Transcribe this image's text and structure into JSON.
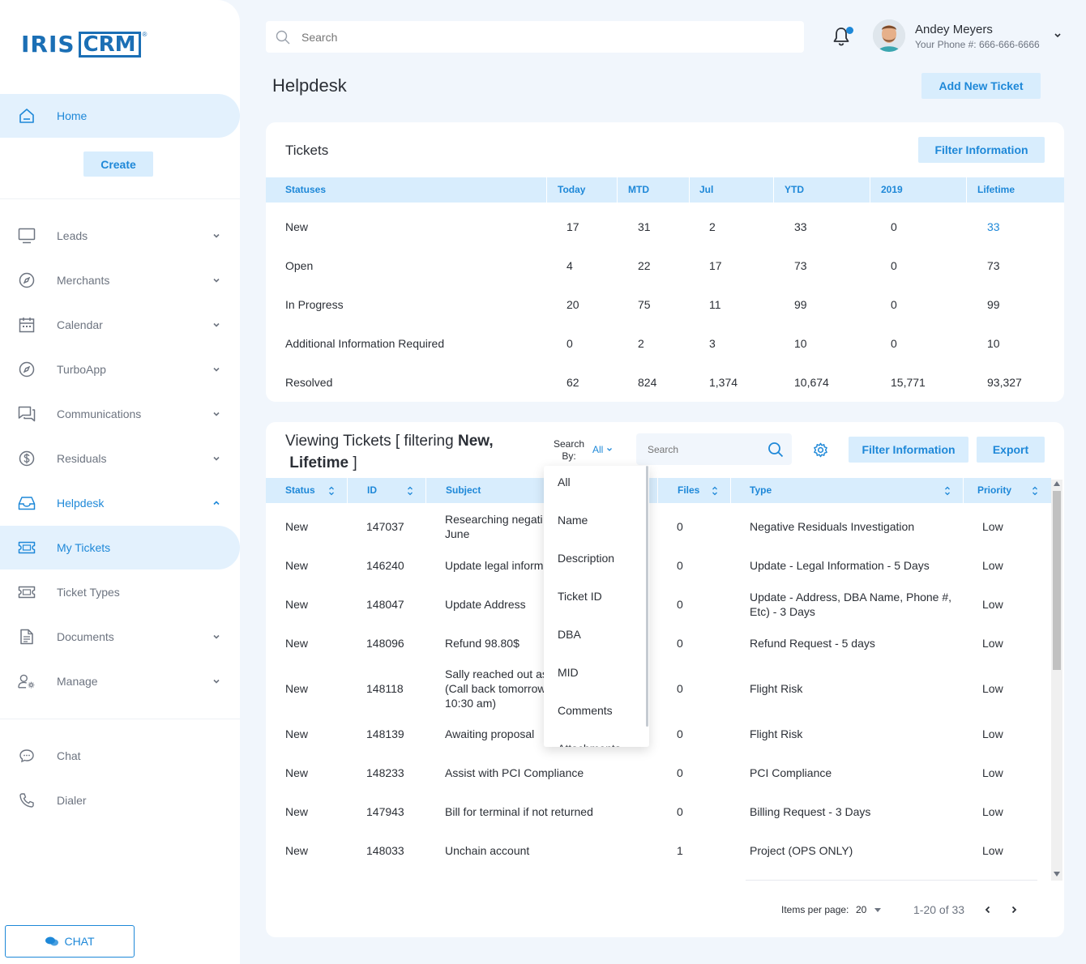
{
  "logo": {
    "part1": "IRIS",
    "part2": "CRM",
    "mark": "®"
  },
  "sidebar": {
    "home": "Home",
    "create": "Create",
    "items": [
      {
        "label": "Leads",
        "icon": "monitor-icon",
        "has_chevron": true
      },
      {
        "label": "Merchants",
        "icon": "compass-icon",
        "has_chevron": true
      },
      {
        "label": "Calendar",
        "icon": "calendar-icon",
        "has_chevron": true
      },
      {
        "label": "TurboApp",
        "icon": "compass-icon",
        "has_chevron": true
      },
      {
        "label": "Communications",
        "icon": "chat-bubbles-icon",
        "has_chevron": true
      },
      {
        "label": "Residuals",
        "icon": "dollar-icon",
        "has_chevron": true
      },
      {
        "label": "Helpdesk",
        "icon": "inbox-icon",
        "has_chevron": true,
        "expanded": true
      },
      {
        "label": "My Tickets",
        "icon": "ticket-icon",
        "has_chevron": false,
        "selected": true
      },
      {
        "label": "Ticket Types",
        "icon": "ticket-icon",
        "has_chevron": false
      },
      {
        "label": "Documents",
        "icon": "document-icon",
        "has_chevron": true
      },
      {
        "label": "Manage",
        "icon": "user-gear-icon",
        "has_chevron": true
      }
    ],
    "bottom": [
      {
        "label": "Chat",
        "icon": "chat-icon"
      },
      {
        "label": "Dialer",
        "icon": "phone-icon"
      }
    ],
    "chat_button": "CHAT"
  },
  "topbar": {
    "search_placeholder": "Search",
    "user_name": "Andey Meyers",
    "user_phone": "Your Phone #: 666-666-6666"
  },
  "page": {
    "title": "Helpdesk",
    "add_ticket": "Add New Ticket"
  },
  "tickets_summary": {
    "title": "Tickets",
    "filter_button": "Filter Information",
    "columns": [
      "Statuses",
      "Today",
      "MTD",
      "Jul",
      "YTD",
      "2019",
      "Lifetime"
    ],
    "rows": [
      [
        "New",
        "17",
        "31",
        "2",
        "33",
        "0",
        "33"
      ],
      [
        "Open",
        "4",
        "22",
        "17",
        "73",
        "0",
        "73"
      ],
      [
        "In Progress",
        "20",
        "75",
        "11",
        "99",
        "0",
        "99"
      ],
      [
        "Additional Information Required",
        "0",
        "2",
        "3",
        "10",
        "0",
        "10"
      ],
      [
        "Resolved",
        "62",
        "824",
        "1,374",
        "10,674",
        "15,771",
        "93,327"
      ]
    ]
  },
  "viewing": {
    "title_line1": "Viewing Tickets [ filtering ",
    "title_bold1": "New,",
    "title_bold2": "Lifetime",
    "title_line2_end": " ]",
    "search_by_line1": "Search",
    "search_by_line2": "By:",
    "search_by_value": "All",
    "search_placeholder": "Search",
    "filter_button": "Filter Information",
    "export_button": "Export",
    "columns": [
      "Status",
      "ID",
      "Subject",
      "Files",
      "Type",
      "Priority"
    ],
    "rows": [
      {
        "status": "New",
        "id": "147037",
        "subject": [
          "Researching negati",
          "June"
        ],
        "files": "0",
        "type": [
          "Negative Residuals Investigation"
        ],
        "priority": "Low"
      },
      {
        "status": "New",
        "id": "146240",
        "subject": [
          "Update legal inform"
        ],
        "files": "0",
        "type": [
          "Update - Legal Information - 5 Days"
        ],
        "priority": "Low"
      },
      {
        "status": "New",
        "id": "148047",
        "subject": [
          "Update Address"
        ],
        "files": "0",
        "type": [
          "Update - Address, DBA Name, Phone #,",
          "Etc) - 3 Days"
        ],
        "priority": "Low"
      },
      {
        "status": "New",
        "id": "148096",
        "subject": [
          "Refund 98.80$"
        ],
        "files": "0",
        "type": [
          "Refund Request - 5 days"
        ],
        "priority": "Low"
      },
      {
        "status": "New",
        "id": "148118",
        "subject": [
          "Sally reached out as",
          "(Call back tomorrow",
          "10:30 am)"
        ],
        "files": "0",
        "type": [
          "Flight Risk"
        ],
        "priority": "Low"
      },
      {
        "status": "New",
        "id": "148139",
        "subject": [
          "Awaiting proposal"
        ],
        "files": "0",
        "type": [
          "Flight Risk"
        ],
        "priority": "Low"
      },
      {
        "status": "New",
        "id": "148233",
        "subject": [
          "Assist with PCI Compliance"
        ],
        "files": "0",
        "type": [
          "PCI Compliance"
        ],
        "priority": "Low"
      },
      {
        "status": "New",
        "id": "147943",
        "subject": [
          "Bill for terminal if not returned"
        ],
        "files": "0",
        "type": [
          "Billing Request - 3 Days"
        ],
        "priority": "Low"
      },
      {
        "status": "New",
        "id": "148033",
        "subject": [
          "Unchain account"
        ],
        "files": "1",
        "type": [
          "Project (OPS ONLY)"
        ],
        "priority": "Low"
      }
    ],
    "dropdown_options": [
      "All",
      "Name",
      "Description",
      "Ticket ID",
      "DBA",
      "MID",
      "Comments",
      "Attachments"
    ],
    "pager": {
      "items_per_page_label": "Items per page:",
      "items_per_page": "20",
      "range": "1-20 of 33"
    }
  },
  "colors": {
    "accent": "#1e88d8",
    "header_bg": "#d8edfd",
    "page_bg": "#f1f6fc"
  }
}
